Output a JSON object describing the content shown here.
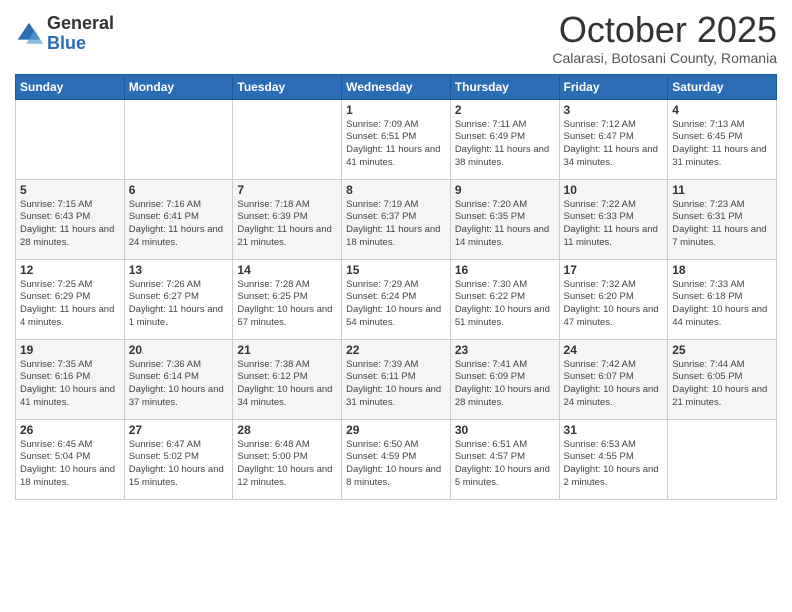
{
  "header": {
    "logo_general": "General",
    "logo_blue": "Blue",
    "month_title": "October 2025",
    "subtitle": "Calarasi, Botosani County, Romania"
  },
  "calendar": {
    "days_of_week": [
      "Sunday",
      "Monday",
      "Tuesday",
      "Wednesday",
      "Thursday",
      "Friday",
      "Saturday"
    ],
    "weeks": [
      [
        {
          "day": "",
          "info": ""
        },
        {
          "day": "",
          "info": ""
        },
        {
          "day": "",
          "info": ""
        },
        {
          "day": "1",
          "info": "Sunrise: 7:09 AM\nSunset: 6:51 PM\nDaylight: 11 hours and 41 minutes."
        },
        {
          "day": "2",
          "info": "Sunrise: 7:11 AM\nSunset: 6:49 PM\nDaylight: 11 hours and 38 minutes."
        },
        {
          "day": "3",
          "info": "Sunrise: 7:12 AM\nSunset: 6:47 PM\nDaylight: 11 hours and 34 minutes."
        },
        {
          "day": "4",
          "info": "Sunrise: 7:13 AM\nSunset: 6:45 PM\nDaylight: 11 hours and 31 minutes."
        }
      ],
      [
        {
          "day": "5",
          "info": "Sunrise: 7:15 AM\nSunset: 6:43 PM\nDaylight: 11 hours and 28 minutes."
        },
        {
          "day": "6",
          "info": "Sunrise: 7:16 AM\nSunset: 6:41 PM\nDaylight: 11 hours and 24 minutes."
        },
        {
          "day": "7",
          "info": "Sunrise: 7:18 AM\nSunset: 6:39 PM\nDaylight: 11 hours and 21 minutes."
        },
        {
          "day": "8",
          "info": "Sunrise: 7:19 AM\nSunset: 6:37 PM\nDaylight: 11 hours and 18 minutes."
        },
        {
          "day": "9",
          "info": "Sunrise: 7:20 AM\nSunset: 6:35 PM\nDaylight: 11 hours and 14 minutes."
        },
        {
          "day": "10",
          "info": "Sunrise: 7:22 AM\nSunset: 6:33 PM\nDaylight: 11 hours and 11 minutes."
        },
        {
          "day": "11",
          "info": "Sunrise: 7:23 AM\nSunset: 6:31 PM\nDaylight: 11 hours and 7 minutes."
        }
      ],
      [
        {
          "day": "12",
          "info": "Sunrise: 7:25 AM\nSunset: 6:29 PM\nDaylight: 11 hours and 4 minutes."
        },
        {
          "day": "13",
          "info": "Sunrise: 7:26 AM\nSunset: 6:27 PM\nDaylight: 11 hours and 1 minute."
        },
        {
          "day": "14",
          "info": "Sunrise: 7:28 AM\nSunset: 6:25 PM\nDaylight: 10 hours and 57 minutes."
        },
        {
          "day": "15",
          "info": "Sunrise: 7:29 AM\nSunset: 6:24 PM\nDaylight: 10 hours and 54 minutes."
        },
        {
          "day": "16",
          "info": "Sunrise: 7:30 AM\nSunset: 6:22 PM\nDaylight: 10 hours and 51 minutes."
        },
        {
          "day": "17",
          "info": "Sunrise: 7:32 AM\nSunset: 6:20 PM\nDaylight: 10 hours and 47 minutes."
        },
        {
          "day": "18",
          "info": "Sunrise: 7:33 AM\nSunset: 6:18 PM\nDaylight: 10 hours and 44 minutes."
        }
      ],
      [
        {
          "day": "19",
          "info": "Sunrise: 7:35 AM\nSunset: 6:16 PM\nDaylight: 10 hours and 41 minutes."
        },
        {
          "day": "20",
          "info": "Sunrise: 7:36 AM\nSunset: 6:14 PM\nDaylight: 10 hours and 37 minutes."
        },
        {
          "day": "21",
          "info": "Sunrise: 7:38 AM\nSunset: 6:12 PM\nDaylight: 10 hours and 34 minutes."
        },
        {
          "day": "22",
          "info": "Sunrise: 7:39 AM\nSunset: 6:11 PM\nDaylight: 10 hours and 31 minutes."
        },
        {
          "day": "23",
          "info": "Sunrise: 7:41 AM\nSunset: 6:09 PM\nDaylight: 10 hours and 28 minutes."
        },
        {
          "day": "24",
          "info": "Sunrise: 7:42 AM\nSunset: 6:07 PM\nDaylight: 10 hours and 24 minutes."
        },
        {
          "day": "25",
          "info": "Sunrise: 7:44 AM\nSunset: 6:05 PM\nDaylight: 10 hours and 21 minutes."
        }
      ],
      [
        {
          "day": "26",
          "info": "Sunrise: 6:45 AM\nSunset: 5:04 PM\nDaylight: 10 hours and 18 minutes."
        },
        {
          "day": "27",
          "info": "Sunrise: 6:47 AM\nSunset: 5:02 PM\nDaylight: 10 hours and 15 minutes."
        },
        {
          "day": "28",
          "info": "Sunrise: 6:48 AM\nSunset: 5:00 PM\nDaylight: 10 hours and 12 minutes."
        },
        {
          "day": "29",
          "info": "Sunrise: 6:50 AM\nSunset: 4:59 PM\nDaylight: 10 hours and 8 minutes."
        },
        {
          "day": "30",
          "info": "Sunrise: 6:51 AM\nSunset: 4:57 PM\nDaylight: 10 hours and 5 minutes."
        },
        {
          "day": "31",
          "info": "Sunrise: 6:53 AM\nSunset: 4:55 PM\nDaylight: 10 hours and 2 minutes."
        },
        {
          "day": "",
          "info": ""
        }
      ]
    ]
  }
}
